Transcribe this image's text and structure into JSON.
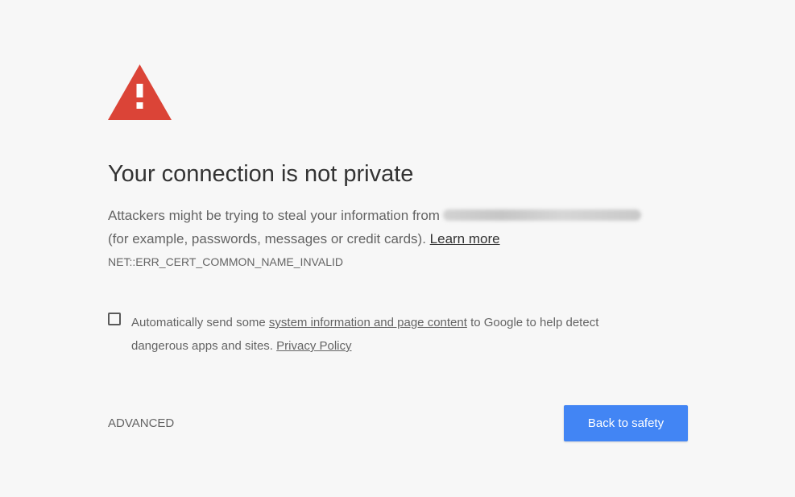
{
  "page": {
    "icon": "warning-triangle-icon",
    "icon_color": "#db4437",
    "title": "Your connection is not private",
    "description": {
      "line1": "Attackers might be trying to steal your information from",
      "line2": "(for example, passwords, messages or credit cards).",
      "learn_more": "Learn more"
    },
    "error_code": "NET::ERR_CERT_COMMON_NAME_INVALID"
  },
  "opt_in": {
    "checked": false,
    "text_before": "Automatically send some",
    "link_label": "system information and page content",
    "text_after": "to Google to help detect",
    "line2": "dangerous apps and sites.",
    "privacy_link": "Privacy Policy"
  },
  "actions": {
    "advanced_label": "ADVANCED",
    "primary_label": "Back to safety",
    "primary_color": "#4285f4"
  }
}
